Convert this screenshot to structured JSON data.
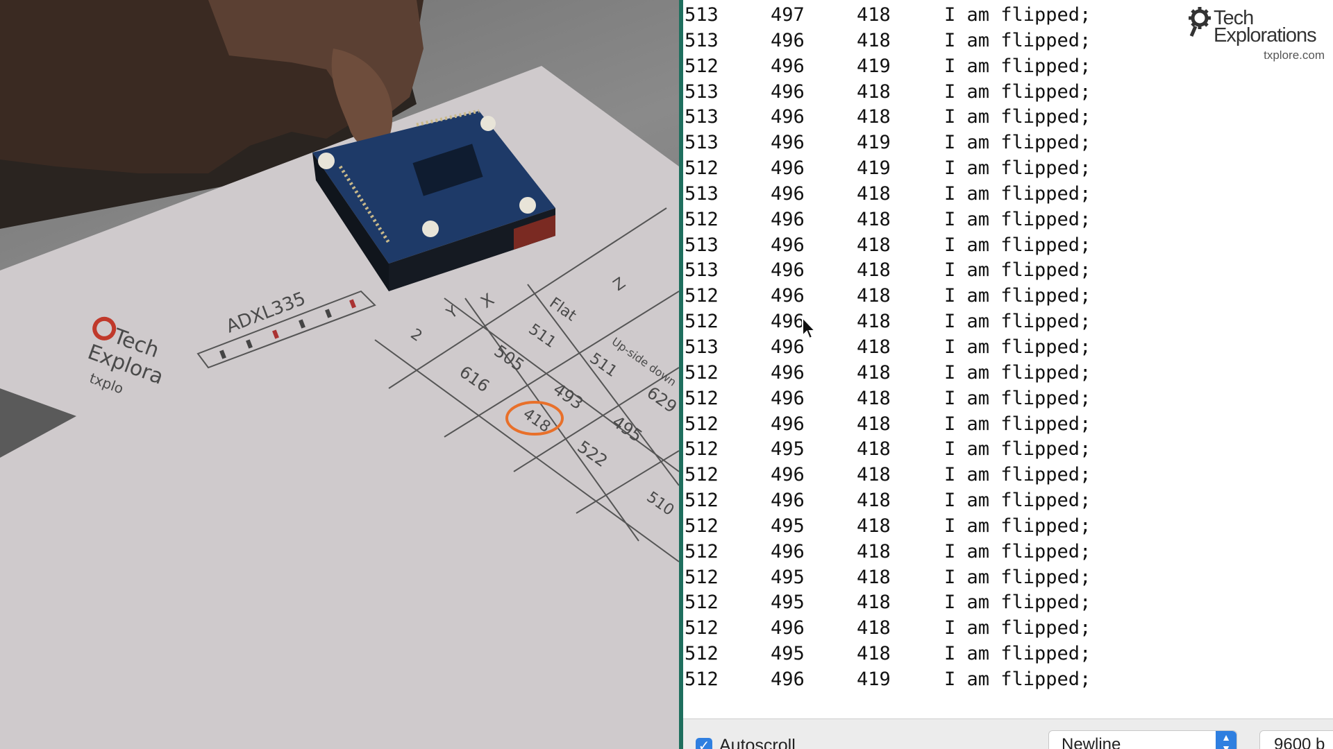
{
  "photo": {
    "paper_label": "ADXL335",
    "paper_logo": [
      "Tech",
      "Explora",
      "txplo"
    ],
    "table_headers": [
      "Flat",
      "Up-side down",
      "X",
      "Y",
      "Z"
    ],
    "table_values": [
      "511",
      "505",
      "616",
      "493",
      "418",
      "511",
      "495",
      "522",
      "629",
      "510",
      "2"
    ],
    "circled_value": "418"
  },
  "monitor": {
    "rows": [
      {
        "a": "513",
        "b": "497",
        "c": "418",
        "msg": "I am flipped;"
      },
      {
        "a": "513",
        "b": "496",
        "c": "418",
        "msg": "I am flipped;"
      },
      {
        "a": "512",
        "b": "496",
        "c": "419",
        "msg": "I am flipped;"
      },
      {
        "a": "513",
        "b": "496",
        "c": "418",
        "msg": "I am flipped;"
      },
      {
        "a": "513",
        "b": "496",
        "c": "418",
        "msg": "I am flipped;"
      },
      {
        "a": "513",
        "b": "496",
        "c": "419",
        "msg": "I am flipped;"
      },
      {
        "a": "512",
        "b": "496",
        "c": "419",
        "msg": "I am flipped;"
      },
      {
        "a": "513",
        "b": "496",
        "c": "418",
        "msg": "I am flipped;"
      },
      {
        "a": "512",
        "b": "496",
        "c": "418",
        "msg": "I am flipped;"
      },
      {
        "a": "513",
        "b": "496",
        "c": "418",
        "msg": "I am flipped;"
      },
      {
        "a": "513",
        "b": "496",
        "c": "418",
        "msg": "I am flipped;"
      },
      {
        "a": "512",
        "b": "496",
        "c": "418",
        "msg": "I am flipped;"
      },
      {
        "a": "512",
        "b": "496",
        "c": "418",
        "msg": "I am flipped;"
      },
      {
        "a": "513",
        "b": "496",
        "c": "418",
        "msg": "I am flipped;"
      },
      {
        "a": "512",
        "b": "496",
        "c": "418",
        "msg": "I am flipped;"
      },
      {
        "a": "512",
        "b": "496",
        "c": "418",
        "msg": "I am flipped;"
      },
      {
        "a": "512",
        "b": "496",
        "c": "418",
        "msg": "I am flipped;"
      },
      {
        "a": "512",
        "b": "495",
        "c": "418",
        "msg": "I am flipped;"
      },
      {
        "a": "512",
        "b": "496",
        "c": "418",
        "msg": "I am flipped;"
      },
      {
        "a": "512",
        "b": "496",
        "c": "418",
        "msg": "I am flipped;"
      },
      {
        "a": "512",
        "b": "495",
        "c": "418",
        "msg": "I am flipped;"
      },
      {
        "a": "512",
        "b": "496",
        "c": "418",
        "msg": "I am flipped;"
      },
      {
        "a": "512",
        "b": "495",
        "c": "418",
        "msg": "I am flipped;"
      },
      {
        "a": "512",
        "b": "495",
        "c": "418",
        "msg": "I am flipped;"
      },
      {
        "a": "512",
        "b": "496",
        "c": "418",
        "msg": "I am flipped;"
      },
      {
        "a": "512",
        "b": "495",
        "c": "418",
        "msg": "I am flipped;"
      },
      {
        "a": "512",
        "b": "496",
        "c": "419",
        "msg": "I am flipped;"
      }
    ],
    "brand": {
      "line1": "Tech",
      "line2": "Explorations",
      "site": "txplore.com"
    },
    "autoscroll": {
      "label": "Autoscroll",
      "checked": true
    },
    "line_ending": {
      "value": "Newline"
    },
    "baud": {
      "value": "9600 b"
    }
  },
  "colors": {
    "accent": "#2f7fe0",
    "divider": "#1f6f5e",
    "logo_red": "#c0392b",
    "circle": "#e8702a"
  },
  "icons": [
    "gear-icon",
    "checkbox-checked-icon",
    "dropdown-arrows-icon",
    "mouse-pointer-icon"
  ]
}
